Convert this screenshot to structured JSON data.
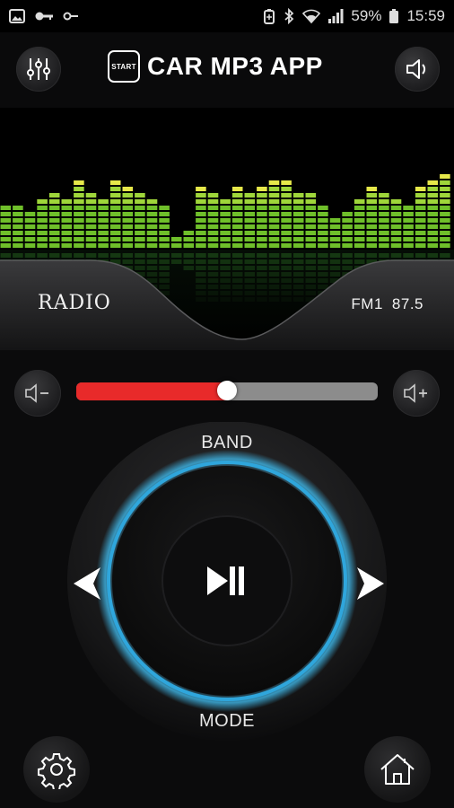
{
  "status_bar": {
    "battery": "59%",
    "time": "15:59",
    "left_icons": [
      "image-icon",
      "key-icon",
      "key-small-icon"
    ],
    "right_icons": [
      "battery-saver-icon",
      "bluetooth-icon",
      "wifi-icon",
      "signal-icon",
      "battery-icon"
    ]
  },
  "header": {
    "badge_text": "START",
    "title": "CAR MP3 APP",
    "left_icon": "equalizer-icon",
    "right_icon": "speaker-icon"
  },
  "display": {
    "source_label": "RADIO",
    "band": "FM1",
    "frequency": "87.5"
  },
  "volume": {
    "level": 0.5,
    "down_icon": "volume-down-icon",
    "up_icon": "volume-up-icon"
  },
  "controls": {
    "band_label": "BAND",
    "mode_label": "MODE",
    "play_pause_icon": "play-pause-icon",
    "prev_icon": "previous-arrow-icon",
    "next_icon": "next-arrow-icon"
  },
  "footer": {
    "settings_icon": "settings-gear-icon",
    "home_icon": "home-icon"
  },
  "colors": {
    "accent_blue": "#3fb7e8",
    "volume_fill": "#e82a2a",
    "eq_green": "#6fbf2a",
    "eq_yellow": "#e6e84a"
  }
}
